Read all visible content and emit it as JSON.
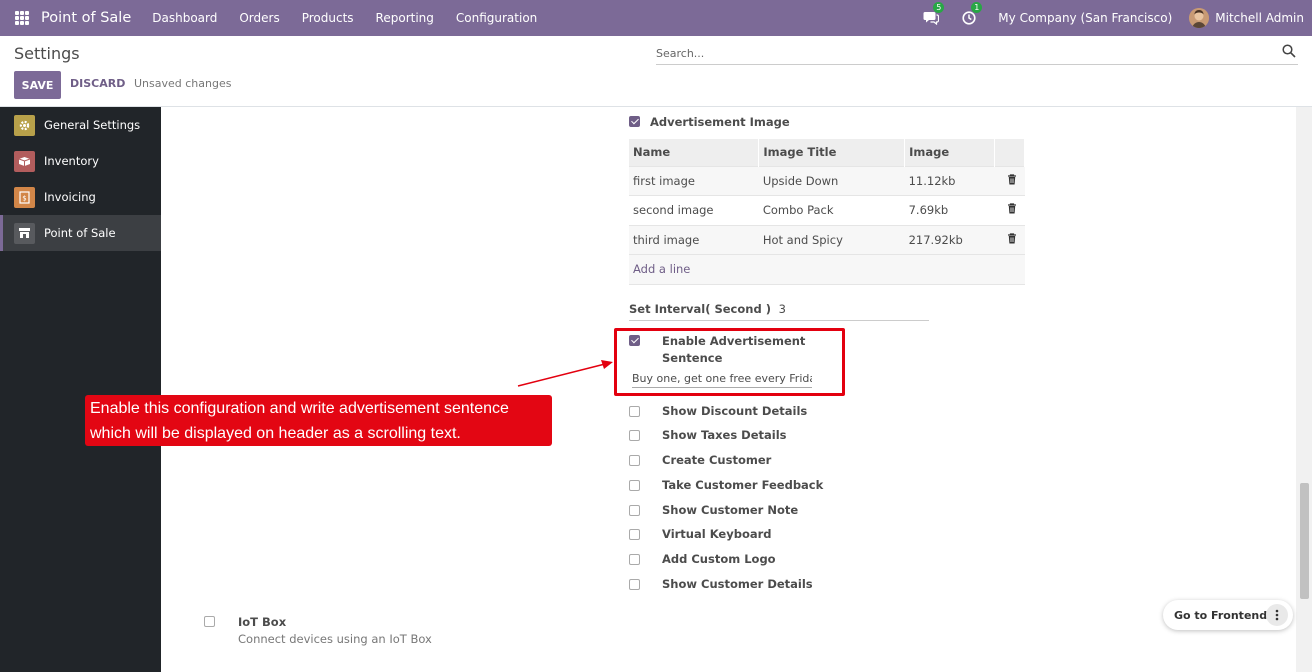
{
  "navbar": {
    "app_name": "Point of Sale",
    "menu": [
      "Dashboard",
      "Orders",
      "Products",
      "Reporting",
      "Configuration"
    ],
    "messages_count": "5",
    "activities_count": "1",
    "company": "My Company (San Francisco)",
    "user": "Mitchell Admin"
  },
  "control_panel": {
    "title": "Settings",
    "save_label": "SAVE",
    "discard_label": "DISCARD",
    "status": "Unsaved changes",
    "search_placeholder": "Search..."
  },
  "sidebar": {
    "items": [
      {
        "label": "General Settings",
        "icon": "gear-icon",
        "color": "#b8a14a"
      },
      {
        "label": "Inventory",
        "icon": "box-icon",
        "color": "#b25d5d"
      },
      {
        "label": "Invoicing",
        "icon": "invoice-icon",
        "color": "#d28648"
      },
      {
        "label": "Point of Sale",
        "icon": "store-icon",
        "color": "#585a5e"
      }
    ]
  },
  "advertisement_image": {
    "label": "Advertisement Image",
    "checked": true,
    "columns": [
      "Name",
      "Image Title",
      "Image"
    ],
    "rows": [
      {
        "name": "first image",
        "title": "Upside Down",
        "image": "11.12kb"
      },
      {
        "name": "second image",
        "title": "Combo Pack",
        "image": "7.69kb"
      },
      {
        "name": "third image",
        "title": "Hot and Spicy",
        "image": "217.92kb"
      }
    ],
    "add_line": "Add a line"
  },
  "interval": {
    "label": "Set Interval( Second )",
    "value": "3"
  },
  "advertisement_sentence": {
    "label_line1": "Enable Advertisement",
    "label_line2": "Sentence",
    "checked": true,
    "value": "Buy one, get one free every Friday!"
  },
  "callout": {
    "line1": "Enable this configuration and write advertisement sentence",
    "line2": "which will be displayed on header as a scrolling text."
  },
  "options": [
    {
      "label": "Show Discount Details",
      "checked": false
    },
    {
      "label": "Show Taxes Details",
      "checked": false
    },
    {
      "label": "Create Customer",
      "checked": false
    },
    {
      "label": "Take Customer Feedback",
      "checked": false
    },
    {
      "label": "Show Customer Note",
      "checked": false
    },
    {
      "label": "Virtual Keyboard",
      "checked": false
    },
    {
      "label": "Add Custom Logo",
      "checked": false
    },
    {
      "label": "Show Customer Details",
      "checked": false
    }
  ],
  "iot": {
    "title": "IoT Box",
    "subtitle": "Connect devices using an IoT Box",
    "checked": false
  },
  "frontend_button": "Go to Frontend",
  "colors": {
    "brand": "#7c6a97",
    "annotation": "#e3000f"
  }
}
